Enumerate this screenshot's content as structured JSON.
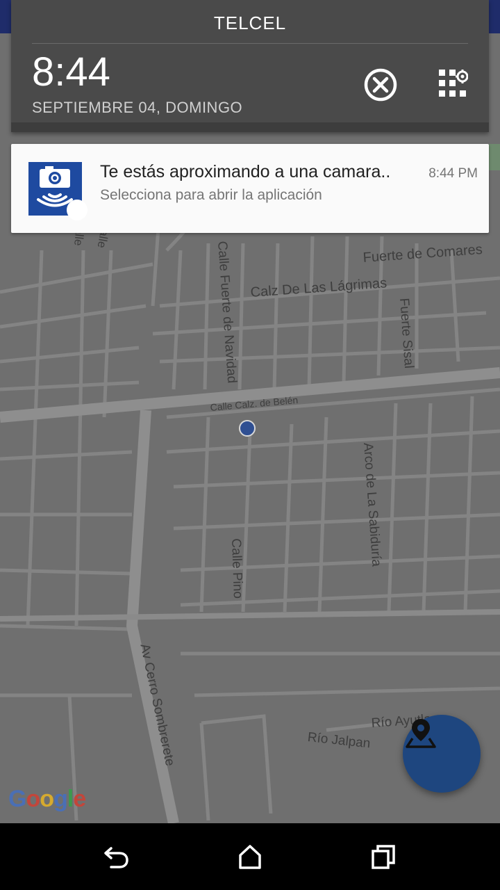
{
  "status_shade": {
    "carrier": "TELCEL",
    "time": "8:44",
    "date": "SEPTIEMBRE 04, DOMINGO",
    "clear_all_icon": "close-circle-icon",
    "settings_icon": "quick-settings-grid-icon"
  },
  "notification": {
    "app_icon": "camera-signal-icon",
    "title": "Te estás aproximando a una camara..",
    "time": "8:44 PM",
    "text": "Selecciona para abrir la aplicación"
  },
  "map": {
    "streets": {
      "fuerte_comares": "Fuerte de Comares",
      "calz_lagrimas": "Calz De Las Lágrimas",
      "fuerte_navidad": "Calle Fuerte de Navidad",
      "fuerte_sisal": "Fuerte Sisal",
      "calz_belen": "Calle Calz. de Belén",
      "arco_sabiduria": "Arco de La Sabiduría",
      "calle_pino": "Calle Pino",
      "av_cerro": "Av Cerro Sombrerete",
      "rio_ayutla": "Río Ayutla",
      "rio_jalpan": "Río Jalpan",
      "calle_left1": "Calle",
      "calle_left2": "Calle"
    },
    "attribution": [
      "G",
      "o",
      "o",
      "g",
      "l",
      "e"
    ]
  },
  "fab": {
    "icon": "map-pin-icon"
  },
  "navbar": {
    "back_icon": "back-icon",
    "home_icon": "home-icon",
    "recents_icon": "recents-icon"
  },
  "colors": {
    "shade_bg": "#4a4a4a",
    "notif_icon_bg": "#1e4aa0",
    "fab_bg": "#1e467f",
    "map_bg": "#6f6f6f",
    "road": "#858585"
  }
}
